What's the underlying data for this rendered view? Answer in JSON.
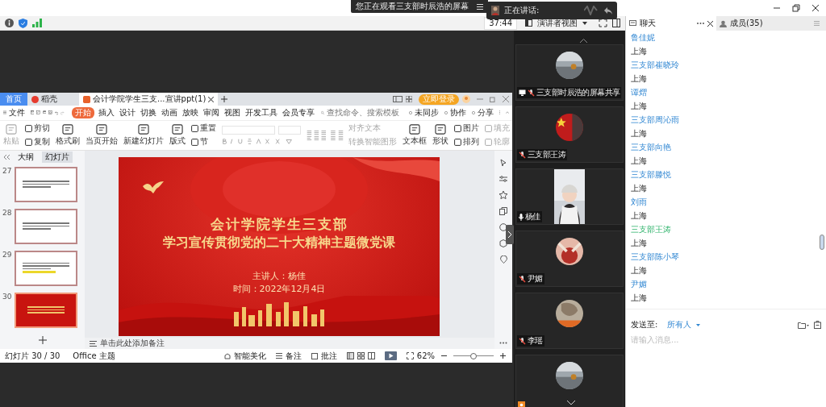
{
  "banner": {
    "text": "您正在观看三支部时辰浩的屏幕"
  },
  "speaking": {
    "label": "正在讲话:"
  },
  "toolbar": {
    "timer": "37:44",
    "view_mode": "演讲者视图"
  },
  "wps": {
    "tabs": [
      {
        "label": "首页",
        "kind": "home",
        "selected": false
      },
      {
        "label": "稻壳",
        "kind": "docer",
        "selected": false
      },
      {
        "label": "会计学院学生三支...宣讲ppt(1)",
        "kind": "doc",
        "selected": true
      }
    ],
    "login": "立即登录",
    "file_menu": "文件",
    "menu": [
      {
        "label": "开始",
        "selected": true
      },
      {
        "label": "插入",
        "selected": false
      },
      {
        "label": "设计",
        "selected": false
      },
      {
        "label": "切换",
        "selected": false
      },
      {
        "label": "动画",
        "selected": false
      },
      {
        "label": "放映",
        "selected": false
      },
      {
        "label": "审阅",
        "selected": false
      },
      {
        "label": "视图",
        "selected": false
      },
      {
        "label": "开发工具",
        "selected": false
      },
      {
        "label": "会员专享",
        "selected": false
      }
    ],
    "search": {
      "placeholder": "查找命令、搜索模板"
    },
    "actions": [
      "未同步",
      "协作",
      "分享"
    ],
    "ribbon": [
      {
        "kind": "big",
        "label": "粘贴",
        "disabled": true
      },
      {
        "kind": "pair",
        "items": [
          {
            "label": "剪切",
            "disabled": false
          },
          {
            "label": "复制",
            "disabled": false
          }
        ]
      },
      {
        "kind": "big",
        "label": "格式刷",
        "disabled": false
      },
      {
        "kind": "big",
        "label": "当页开始",
        "disabled": false
      },
      {
        "kind": "big",
        "label": "新建幻灯片",
        "disabled": false
      },
      {
        "kind": "big",
        "label": "版式",
        "disabled": false
      },
      {
        "kind": "pair",
        "items": [
          {
            "label": "重置",
            "disabled": false
          },
          {
            "label": "节",
            "disabled": false
          }
        ]
      },
      {
        "kind": "font"
      },
      {
        "kind": "paragraph",
        "items": [
          {
            "label": "对齐文本",
            "disabled": true
          },
          {
            "label": "转换智能图形",
            "disabled": true
          }
        ]
      },
      {
        "kind": "big",
        "label": "文本框",
        "disabled": false
      },
      {
        "kind": "big",
        "label": "形状",
        "disabled": false
      },
      {
        "kind": "pair",
        "items": [
          {
            "label": "图片",
            "disabled": false
          },
          {
            "label": "排列",
            "disabled": false
          }
        ]
      },
      {
        "kind": "pair",
        "items": [
          {
            "label": "填充",
            "disabled": true
          },
          {
            "label": "轮廓",
            "disabled": true
          }
        ]
      }
    ],
    "panel_tabs": [
      {
        "label": "大纲",
        "selected": false
      },
      {
        "label": "幻灯片",
        "selected": true
      }
    ],
    "thumbnails": [
      {
        "number": "27",
        "kind": "text",
        "selected": false
      },
      {
        "number": "28",
        "kind": "text",
        "selected": false
      },
      {
        "number": "29",
        "kind": "highlight",
        "selected": false
      },
      {
        "number": "30",
        "kind": "title",
        "selected": true
      }
    ],
    "slide": {
      "title": "会计学院学生三支部",
      "subtitle": "学习宣传贯彻党的二十大精神主题微党课",
      "presenter": "主讲人：杨佳",
      "date": "时间：2022年12月4日"
    },
    "notes": {
      "placeholder": "单击此处添加备注"
    },
    "status": {
      "slide_count": "幻灯片 30 / 30",
      "theme": "Office 主题",
      "beautify": "智能美化",
      "notes": "备注",
      "comments": "批注",
      "zoom": "62%"
    },
    "zoom_slider": {
      "level": 0.5
    }
  },
  "videos": [
    {
      "name": "三支部时辰浩的屏幕共享",
      "kind": "screen_share"
    },
    {
      "name": "三支部王涛",
      "kind": "avatar"
    },
    {
      "name": "杨佳",
      "kind": "camera"
    },
    {
      "name": "尹媚",
      "kind": "avatar"
    },
    {
      "name": "李瑶",
      "kind": "avatar"
    },
    {
      "kind": "avatar"
    }
  ],
  "chat": {
    "tabs": [
      {
        "label": "聊天",
        "selected": true
      },
      {
        "label": "成员(35)",
        "selected": false
      }
    ],
    "messages": [
      {
        "sender": "鲁佳妮",
        "self": false,
        "text": "上海"
      },
      {
        "sender": "三支部崔晓玲",
        "self": false,
        "text": "上海"
      },
      {
        "sender": "谭熠",
        "self": false,
        "text": "上海"
      },
      {
        "sender": "三支部周沁雨",
        "self": false,
        "text": "上海"
      },
      {
        "sender": "三支部向艳",
        "self": false,
        "text": "上海"
      },
      {
        "sender": "三支部滕悦",
        "self": false,
        "text": "上海"
      },
      {
        "sender": "刘雨",
        "self": false,
        "text": "上海"
      },
      {
        "sender": "三支部王涛",
        "self": true,
        "text": "上海"
      },
      {
        "sender": "三支部陈小琴",
        "self": false,
        "text": "上海"
      },
      {
        "sender": "尹媚",
        "self": false,
        "text": "上海"
      }
    ],
    "send_to_label": "发送至:",
    "recipient": "所有人",
    "placeholder": "请输入消息..."
  }
}
